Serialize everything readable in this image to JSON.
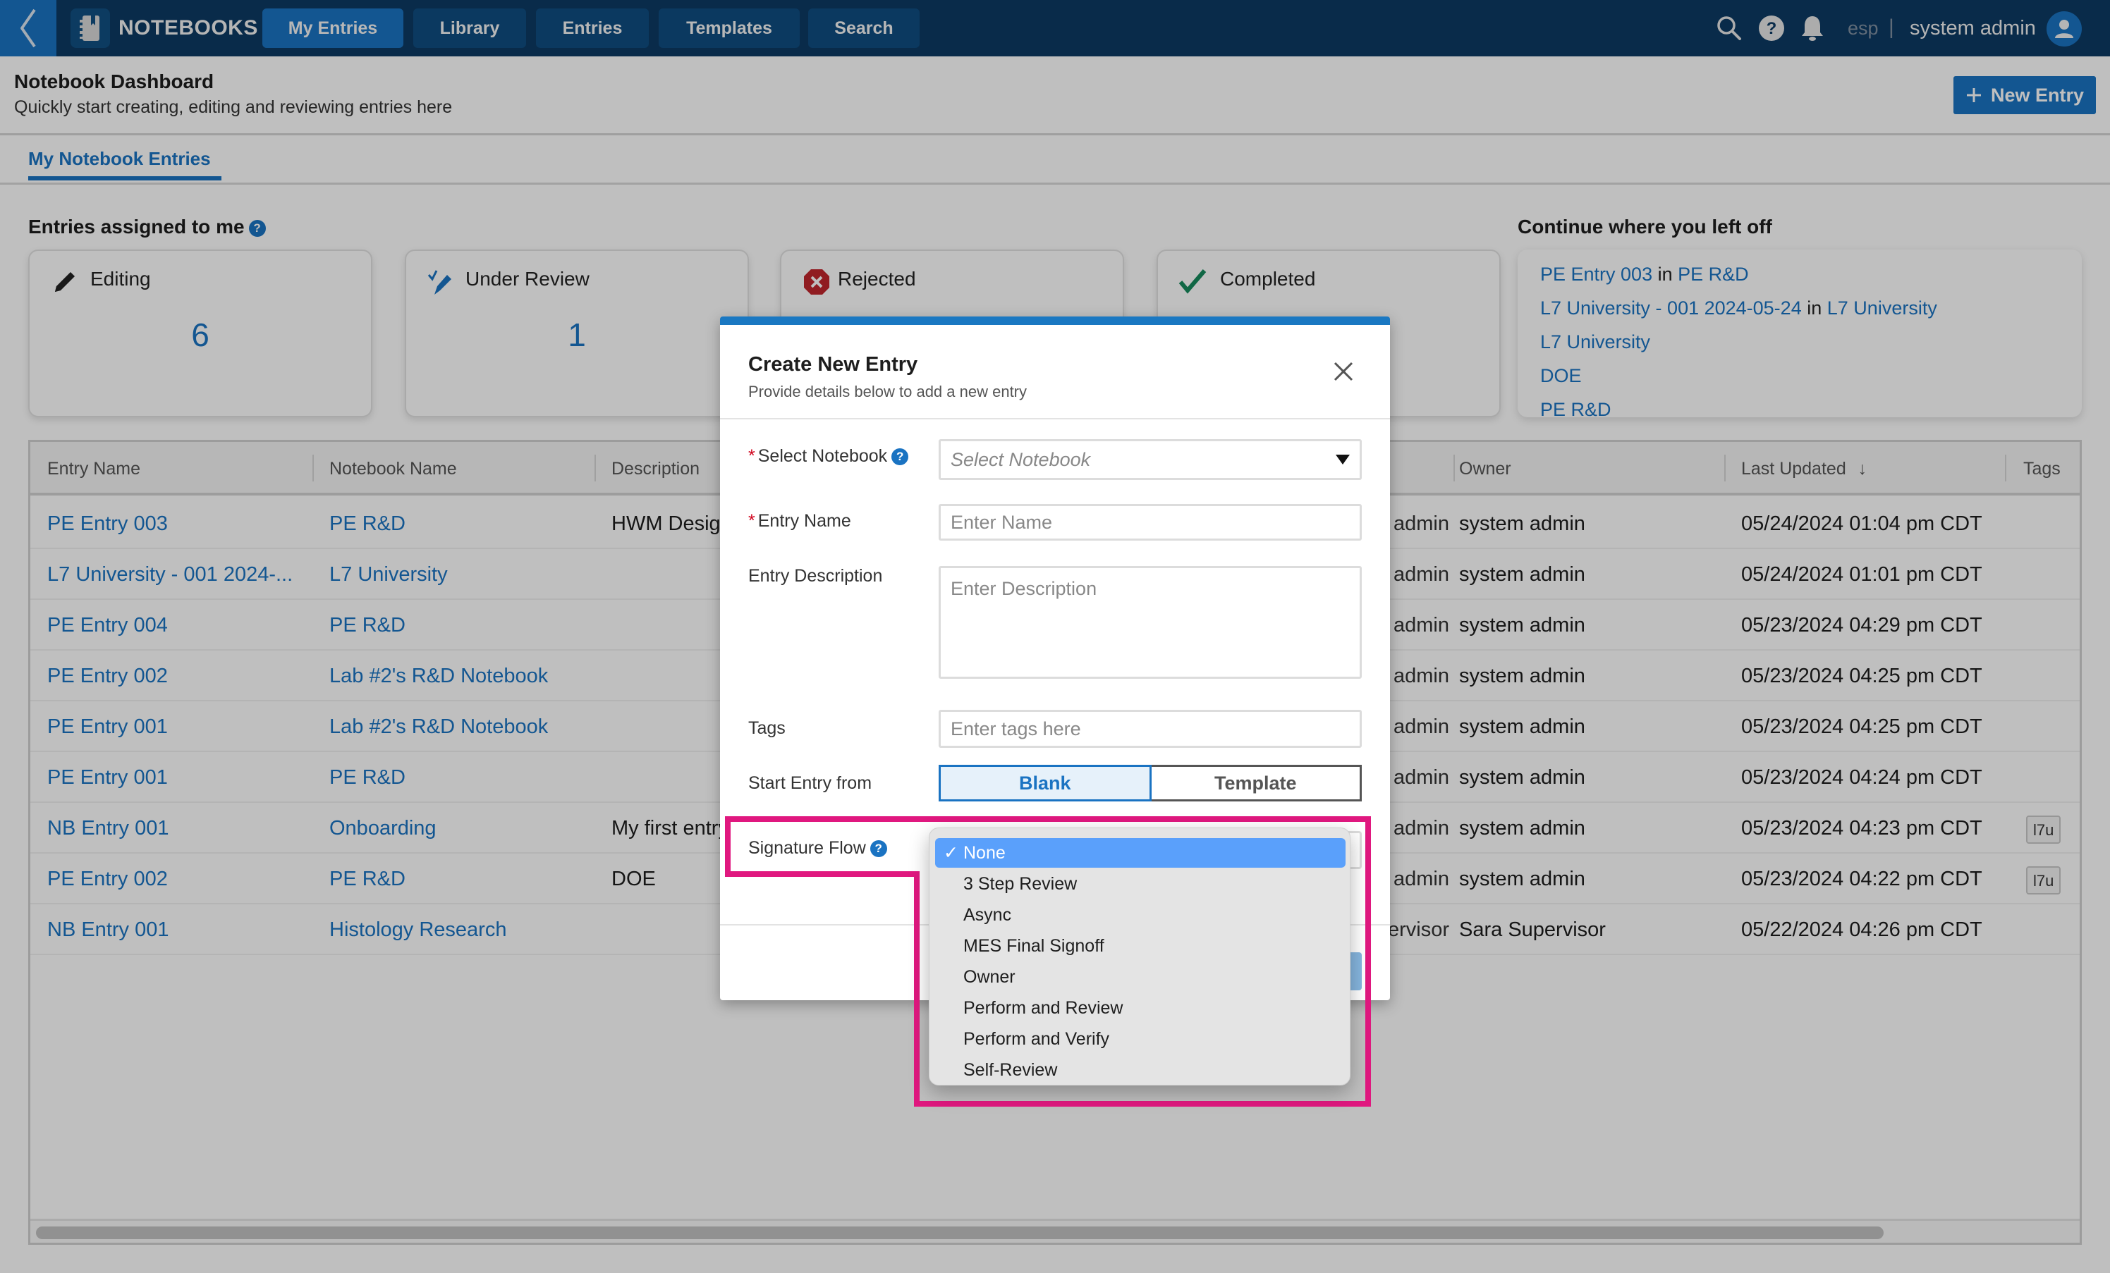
{
  "app": {
    "brand": "NOTEBOOKS",
    "nav_tabs": [
      {
        "label": "My Entries",
        "active": true
      },
      {
        "label": "Library",
        "active": false
      },
      {
        "label": "Entries",
        "active": false
      },
      {
        "label": "Templates",
        "active": false
      },
      {
        "label": "Search",
        "active": false
      }
    ],
    "language": "esp",
    "separator": "|",
    "user_name": "system admin",
    "icons": [
      "back-chevron-icon",
      "notebook-icon",
      "search-icon",
      "help-icon",
      "bell-icon",
      "user-icon"
    ]
  },
  "header": {
    "title": "Notebook Dashboard",
    "subtitle": "Quickly start creating, editing and reviewing entries here",
    "new_entry_label": "New Entry"
  },
  "subtab": {
    "label": "My Notebook Entries"
  },
  "assigned": {
    "title": "Entries assigned to me",
    "cards": [
      {
        "label": "Editing",
        "count": "6",
        "icon": "pencil-icon"
      },
      {
        "label": "Under Review",
        "count": "1",
        "icon": "review-icon"
      },
      {
        "label": "Rejected",
        "count": "",
        "icon": "rejected-icon"
      },
      {
        "label": "Completed",
        "count": "",
        "icon": "checkmark-icon"
      }
    ]
  },
  "continue": {
    "title": "Continue where you left off",
    "items": [
      {
        "entry": "PE Entry 003",
        "joiner": "in",
        "notebook": "PE R&D"
      },
      {
        "entry": "L7 University - 001 2024-05-24",
        "joiner": "in",
        "notebook": "L7 University"
      },
      {
        "entry": "L7 University",
        "joiner": "",
        "notebook": ""
      },
      {
        "entry": "DOE",
        "joiner": "",
        "notebook": ""
      },
      {
        "entry": "PE R&D",
        "joiner": "",
        "notebook": ""
      }
    ]
  },
  "table": {
    "columns": [
      "Entry Name",
      "Notebook Name",
      "Description",
      "",
      "Owner",
      "Last Updated",
      "Tags"
    ],
    "sort_indicator": "↓",
    "rows": [
      {
        "entry": "PE Entry 003",
        "notebook": "PE R&D",
        "description": "HWM Design",
        "assigned": "system admin",
        "owner": "system admin",
        "updated": "05/24/2024 01:04 pm CDT",
        "tag": ""
      },
      {
        "entry": "L7 University - 001 2024-...",
        "notebook": "L7 University",
        "description": "",
        "assigned": "system admin",
        "owner": "system admin",
        "updated": "05/24/2024 01:01 pm CDT",
        "tag": ""
      },
      {
        "entry": "PE Entry 004",
        "notebook": "PE R&D",
        "description": "",
        "assigned": "system admin",
        "owner": "system admin",
        "updated": "05/23/2024 04:29 pm CDT",
        "tag": ""
      },
      {
        "entry": "PE Entry 002",
        "notebook": "Lab #2's R&D Notebook",
        "description": "",
        "assigned": "system admin",
        "owner": "system admin",
        "updated": "05/23/2024 04:25 pm CDT",
        "tag": ""
      },
      {
        "entry": "PE Entry 001",
        "notebook": "Lab #2's R&D Notebook",
        "description": "",
        "assigned": "system admin",
        "owner": "system admin",
        "updated": "05/23/2024 04:25 pm CDT",
        "tag": ""
      },
      {
        "entry": "PE Entry 001",
        "notebook": "PE R&D",
        "description": "",
        "assigned": "system admin",
        "owner": "system admin",
        "updated": "05/23/2024 04:24 pm CDT",
        "tag": ""
      },
      {
        "entry": "NB Entry 001",
        "notebook": "Onboarding",
        "description": "My first entry",
        "assigned": "system admin",
        "owner": "system admin",
        "updated": "05/23/2024 04:23 pm CDT",
        "tag": "l7u"
      },
      {
        "entry": "PE Entry 002",
        "notebook": "PE R&D",
        "description": "DOE",
        "assigned": "system admin",
        "owner": "system admin",
        "updated": "05/23/2024 04:22 pm CDT",
        "tag": "l7u"
      },
      {
        "entry": "NB Entry 001",
        "notebook": "Histology Research",
        "description": "",
        "assigned": "Sara Supervisor",
        "owner": "Sara Supervisor",
        "updated": "05/22/2024 04:26 pm CDT",
        "tag": ""
      }
    ]
  },
  "modal": {
    "title": "Create New Entry",
    "subtitle": "Provide details below to add a new entry",
    "fields": {
      "notebook": {
        "label": "Select Notebook",
        "required": true,
        "placeholder": "Select Notebook"
      },
      "name": {
        "label": "Entry Name",
        "required": true,
        "placeholder": "Enter Name"
      },
      "description": {
        "label": "Entry Description",
        "placeholder": "Enter Description"
      },
      "tags": {
        "label": "Tags",
        "placeholder": "Enter tags here"
      },
      "start_from": {
        "label": "Start Entry from",
        "options": [
          "Blank",
          "Template"
        ],
        "selected": "Blank"
      },
      "signature_flow": {
        "label": "Signature Flow",
        "selected": "None"
      }
    }
  },
  "signature_dropdown": {
    "check": "✓",
    "options": [
      "None",
      "3 Step Review",
      "Async",
      "MES Final Signoff",
      "Owner",
      "Perform and Review",
      "Perform and Verify",
      "Self-Review"
    ],
    "selected_index": 0
  },
  "colors": {
    "brand_blue": "#1a73c2",
    "nav_bg": "#0c3a63",
    "highlight": "#e0187f",
    "rejected": "#c0262d",
    "completed": "#168a5c",
    "dropdown_selected": "#5aa0fb"
  }
}
